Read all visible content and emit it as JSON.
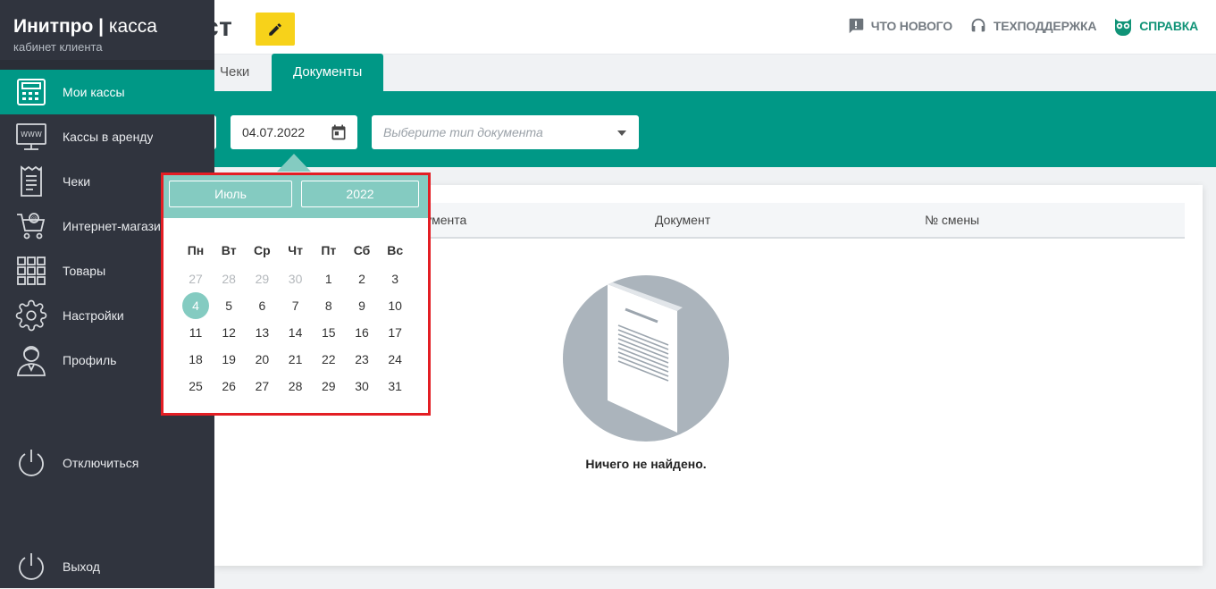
{
  "header": {
    "page_title_partial": "ст",
    "links": [
      {
        "label": "ЧТО НОВОГО",
        "icon": "comment-alert-icon"
      },
      {
        "label": "ТЕХПОДДЕРЖКА",
        "icon": "headset-icon"
      },
      {
        "label": "СПРАВКА",
        "icon": "owl-icon",
        "color": "#109377"
      }
    ]
  },
  "tabs": [
    {
      "label": "Чеки",
      "active": false
    },
    {
      "label": "Документы",
      "active": true
    }
  ],
  "filters": {
    "date_value": "04.07.2022",
    "doc_type_placeholder": "Выберите тип документа"
  },
  "table": {
    "columns": [
      "кумента",
      "Документ",
      "№ смены"
    ]
  },
  "empty_state": {
    "text": "Ничего не найдено."
  },
  "sidebar": {
    "brand_bold": "Инитпро",
    "brand_sep": "|",
    "brand_light": "касса",
    "brand_sub": "кабинет клиента",
    "items": [
      {
        "label": "Мои кассы",
        "icon": "cash-register-icon",
        "active": true
      },
      {
        "label": "Кассы в аренду",
        "icon": "www-monitor-icon"
      },
      {
        "label": "Чеки",
        "icon": "receipt-icon"
      },
      {
        "label": "Интернет-магазин",
        "icon": "shopping-cart-icon"
      },
      {
        "label": "Товары",
        "icon": "grid-icon"
      },
      {
        "label": "Настройки",
        "icon": "gear-icon"
      },
      {
        "label": "Профиль",
        "icon": "user-icon"
      }
    ],
    "disconnect_label": "Отключиться",
    "logout_label": "Выход"
  },
  "calendar": {
    "month": "Июль",
    "year": "2022",
    "weekdays": [
      "Пн",
      "Вт",
      "Ср",
      "Чт",
      "Пт",
      "Сб",
      "Вс"
    ],
    "weeks": [
      [
        "27",
        "28",
        "29",
        "30",
        "1",
        "2",
        "3"
      ],
      [
        "4",
        "5",
        "6",
        "7",
        "8",
        "9",
        "10"
      ],
      [
        "11",
        "12",
        "13",
        "14",
        "15",
        "16",
        "17"
      ],
      [
        "18",
        "19",
        "20",
        "21",
        "22",
        "23",
        "24"
      ],
      [
        "25",
        "26",
        "27",
        "28",
        "29",
        "30",
        "31"
      ]
    ],
    "muted_prev_count": 4,
    "selected": "4",
    "accent": "#84cbc1",
    "highlight_border": "#e31e24"
  },
  "colors": {
    "primary": "#009886",
    "sidebar": "#30343e",
    "edit_button": "#f7d21a"
  }
}
